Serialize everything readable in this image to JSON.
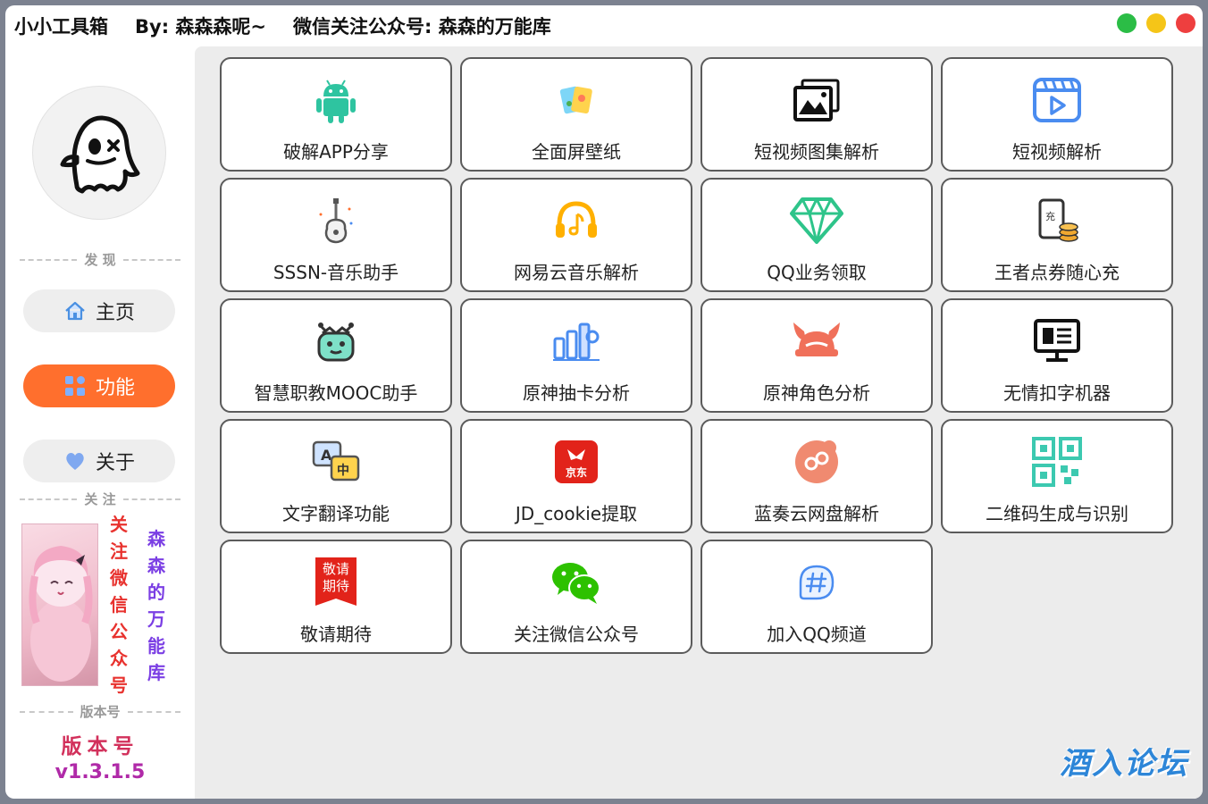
{
  "title": {
    "app_name": "小小工具箱",
    "author": "By: 森森森呢~",
    "wechat": "微信关注公众号: 森森的万能库"
  },
  "sidebar": {
    "section_discover": "发 现",
    "nav": [
      {
        "label": "主页",
        "icon": "home-icon"
      },
      {
        "label": "功能",
        "icon": "grid-icon",
        "active": true
      },
      {
        "label": "关于",
        "icon": "heart-icon"
      }
    ],
    "section_follow": "关 注",
    "follow_text_red": "关注微信公众号",
    "follow_text_purple": "森森的万能库",
    "section_version": "版本号",
    "version_label": "版本号",
    "version": "v1.3.1.5"
  },
  "cards": [
    {
      "label": "破解APP分享",
      "icon": "android-icon"
    },
    {
      "label": "全面屏壁纸",
      "icon": "wallpaper-icon"
    },
    {
      "label": "短视频图集解析",
      "icon": "image-gallery-icon"
    },
    {
      "label": "短视频解析",
      "icon": "video-icon"
    },
    {
      "label": "SSSN-音乐助手",
      "icon": "guitar-icon"
    },
    {
      "label": "网易云音乐解析",
      "icon": "headphones-icon"
    },
    {
      "label": "QQ业务领取",
      "icon": "diamond-icon"
    },
    {
      "label": "王者点券随心充",
      "icon": "coin-phone-icon"
    },
    {
      "label": "智慧职教MOOC助手",
      "icon": "robot-icon"
    },
    {
      "label": "原神抽卡分析",
      "icon": "bar-chart-icon"
    },
    {
      "label": "原神角色分析",
      "icon": "horned-helmet-icon"
    },
    {
      "label": "无情扣字机器",
      "icon": "monitor-icon"
    },
    {
      "label": "文字翻译功能",
      "icon": "translate-icon"
    },
    {
      "label": "JD_cookie提取",
      "icon": "jd-icon",
      "icon_text": "京东"
    },
    {
      "label": "蓝奏云网盘解析",
      "icon": "cloud-disk-icon"
    },
    {
      "label": "二维码生成与识别",
      "icon": "qr-code-icon"
    },
    {
      "label": "敬请期待",
      "icon": "coming-soon-icon",
      "icon_text": "敬请期待"
    },
    {
      "label": "关注微信公众号",
      "icon": "wechat-icon"
    },
    {
      "label": "加入QQ频道",
      "icon": "channel-icon"
    }
  ],
  "watermark": "酒入论坛",
  "colors": {
    "accent": "#ff6f2d",
    "card_border": "#5b5b5b",
    "content_bg": "#ececec"
  }
}
